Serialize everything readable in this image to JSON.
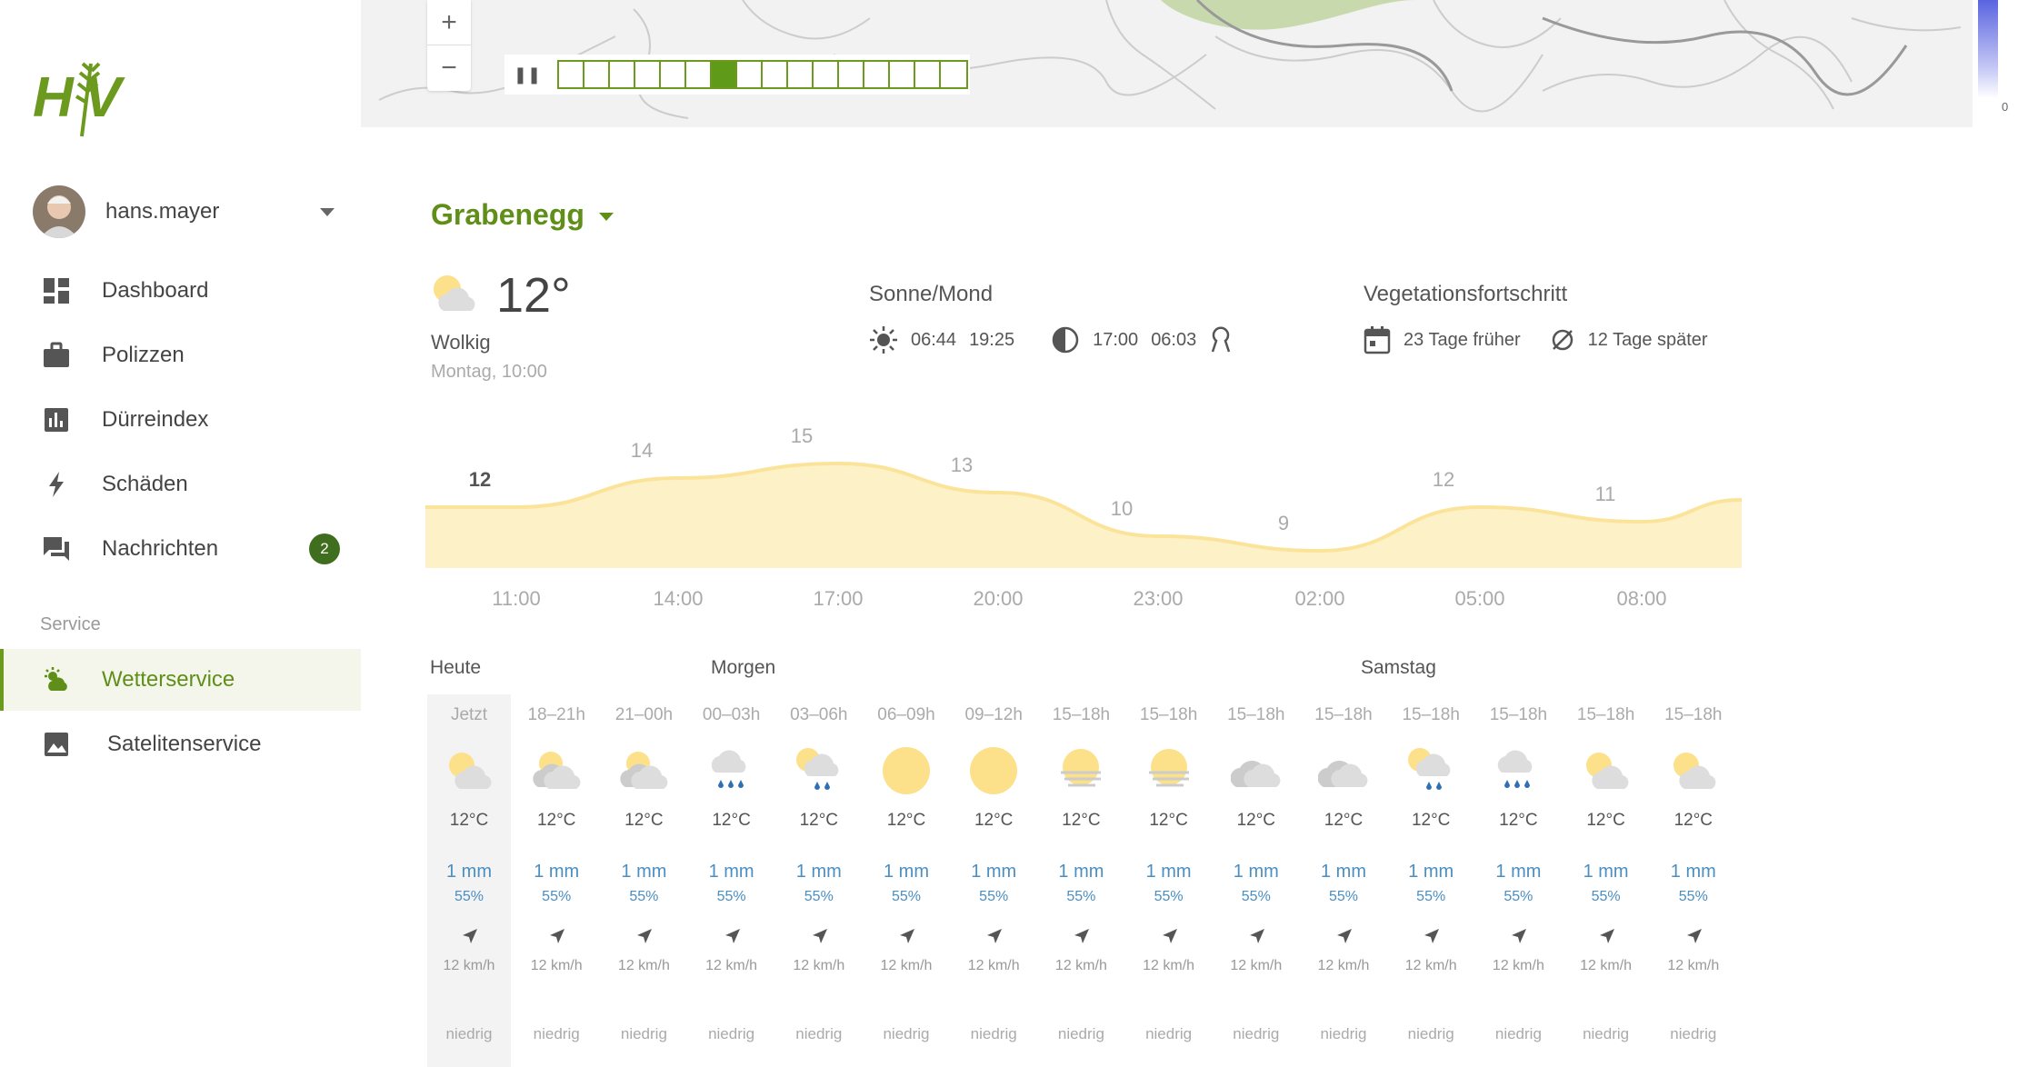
{
  "user": {
    "name": "hans.mayer"
  },
  "nav": [
    {
      "label": "Dashboard",
      "icon": "dashboard-icon"
    },
    {
      "label": "Polizzen",
      "icon": "briefcase-icon"
    },
    {
      "label": "Dürreindex",
      "icon": "bar-chart-icon"
    },
    {
      "label": "Schäden",
      "icon": "lightning-icon"
    },
    {
      "label": "Nachrichten",
      "icon": "chat-icon",
      "badge": "2"
    }
  ],
  "service_label": "Service",
  "service_nav": [
    {
      "label": "Wetterservice",
      "icon": "weather-icon",
      "active": true
    },
    {
      "label": "Satelitenservice",
      "icon": "image-icon"
    }
  ],
  "map": {
    "zoom_in": "+",
    "zoom_out": "−",
    "legend_value": "0",
    "active_step": 6,
    "steps": 16
  },
  "location": "Grabenegg",
  "current": {
    "temp": "12°",
    "desc": "Wolkig",
    "time": "Montag, 10:00",
    "icon": "partly-cloudy-icon"
  },
  "sun_moon": {
    "title": "Sonne/Mond",
    "sunrise": "06:44",
    "sunset": "19:25",
    "moonrise": "17:00",
    "moonset": "06:03"
  },
  "vegetation": {
    "title": "Vegetationsfortschritt",
    "earlier": "23 Tage früher",
    "later": "12 Tage später"
  },
  "chart_data": {
    "type": "area",
    "x": [
      "11:00",
      "14:00",
      "17:00",
      "20:00",
      "23:00",
      "02:00",
      "05:00",
      "08:00"
    ],
    "values": [
      12,
      14,
      15,
      13,
      10,
      9,
      12,
      11
    ],
    "color": "#fbe49a"
  },
  "days": [
    {
      "label": "Heute"
    },
    {
      "label": "Morgen"
    },
    {
      "label": "Samstag"
    }
  ],
  "forecast": [
    {
      "t": "Jetzt",
      "icon": "partly-cloudy",
      "temp": "12°C",
      "mm": "1 mm",
      "pct": "55%",
      "wind": "12 km/h",
      "level": "niedrig"
    },
    {
      "t": "18–21h",
      "icon": "cloudy-sun",
      "temp": "12°C",
      "mm": "1 mm",
      "pct": "55%",
      "wind": "12 km/h",
      "level": "niedrig"
    },
    {
      "t": "21–00h",
      "icon": "cloudy-sun",
      "temp": "12°C",
      "mm": "1 mm",
      "pct": "55%",
      "wind": "12 km/h",
      "level": "niedrig"
    },
    {
      "t": "00–03h",
      "icon": "rain",
      "temp": "12°C",
      "mm": "1 mm",
      "pct": "55%",
      "wind": "12 km/h",
      "level": "niedrig"
    },
    {
      "t": "03–06h",
      "icon": "sun-rain",
      "temp": "12°C",
      "mm": "1 mm",
      "pct": "55%",
      "wind": "12 km/h",
      "level": "niedrig"
    },
    {
      "t": "06–09h",
      "icon": "sun",
      "temp": "12°C",
      "mm": "1 mm",
      "pct": "55%",
      "wind": "12 km/h",
      "level": "niedrig"
    },
    {
      "t": "09–12h",
      "icon": "sun",
      "temp": "12°C",
      "mm": "1 mm",
      "pct": "55%",
      "wind": "12 km/h",
      "level": "niedrig"
    },
    {
      "t": "15–18h",
      "icon": "sun-fog",
      "temp": "12°C",
      "mm": "1 mm",
      "pct": "55%",
      "wind": "12 km/h",
      "level": "niedrig"
    },
    {
      "t": "15–18h",
      "icon": "sun-fog",
      "temp": "12°C",
      "mm": "1 mm",
      "pct": "55%",
      "wind": "12 km/h",
      "level": "niedrig"
    },
    {
      "t": "15–18h",
      "icon": "cloud",
      "temp": "12°C",
      "mm": "1 mm",
      "pct": "55%",
      "wind": "12 km/h",
      "level": "niedrig"
    },
    {
      "t": "15–18h",
      "icon": "cloud",
      "temp": "12°C",
      "mm": "1 mm",
      "pct": "55%",
      "wind": "12 km/h",
      "level": "niedrig"
    },
    {
      "t": "15–18h",
      "icon": "sun-rain",
      "temp": "12°C",
      "mm": "1 mm",
      "pct": "55%",
      "wind": "12 km/h",
      "level": "niedrig"
    },
    {
      "t": "15–18h",
      "icon": "rain",
      "temp": "12°C",
      "mm": "1 mm",
      "pct": "55%",
      "wind": "12 km/h",
      "level": "niedrig"
    },
    {
      "t": "15–18h",
      "icon": "partly-cloudy",
      "temp": "12°C",
      "mm": "1 mm",
      "pct": "55%",
      "wind": "12 km/h",
      "level": "niedrig"
    },
    {
      "t": "15–18h",
      "icon": "partly-cloudy",
      "temp": "12°C",
      "mm": "1 mm",
      "pct": "55%",
      "wind": "12 km/h",
      "level": "niedrig"
    }
  ]
}
